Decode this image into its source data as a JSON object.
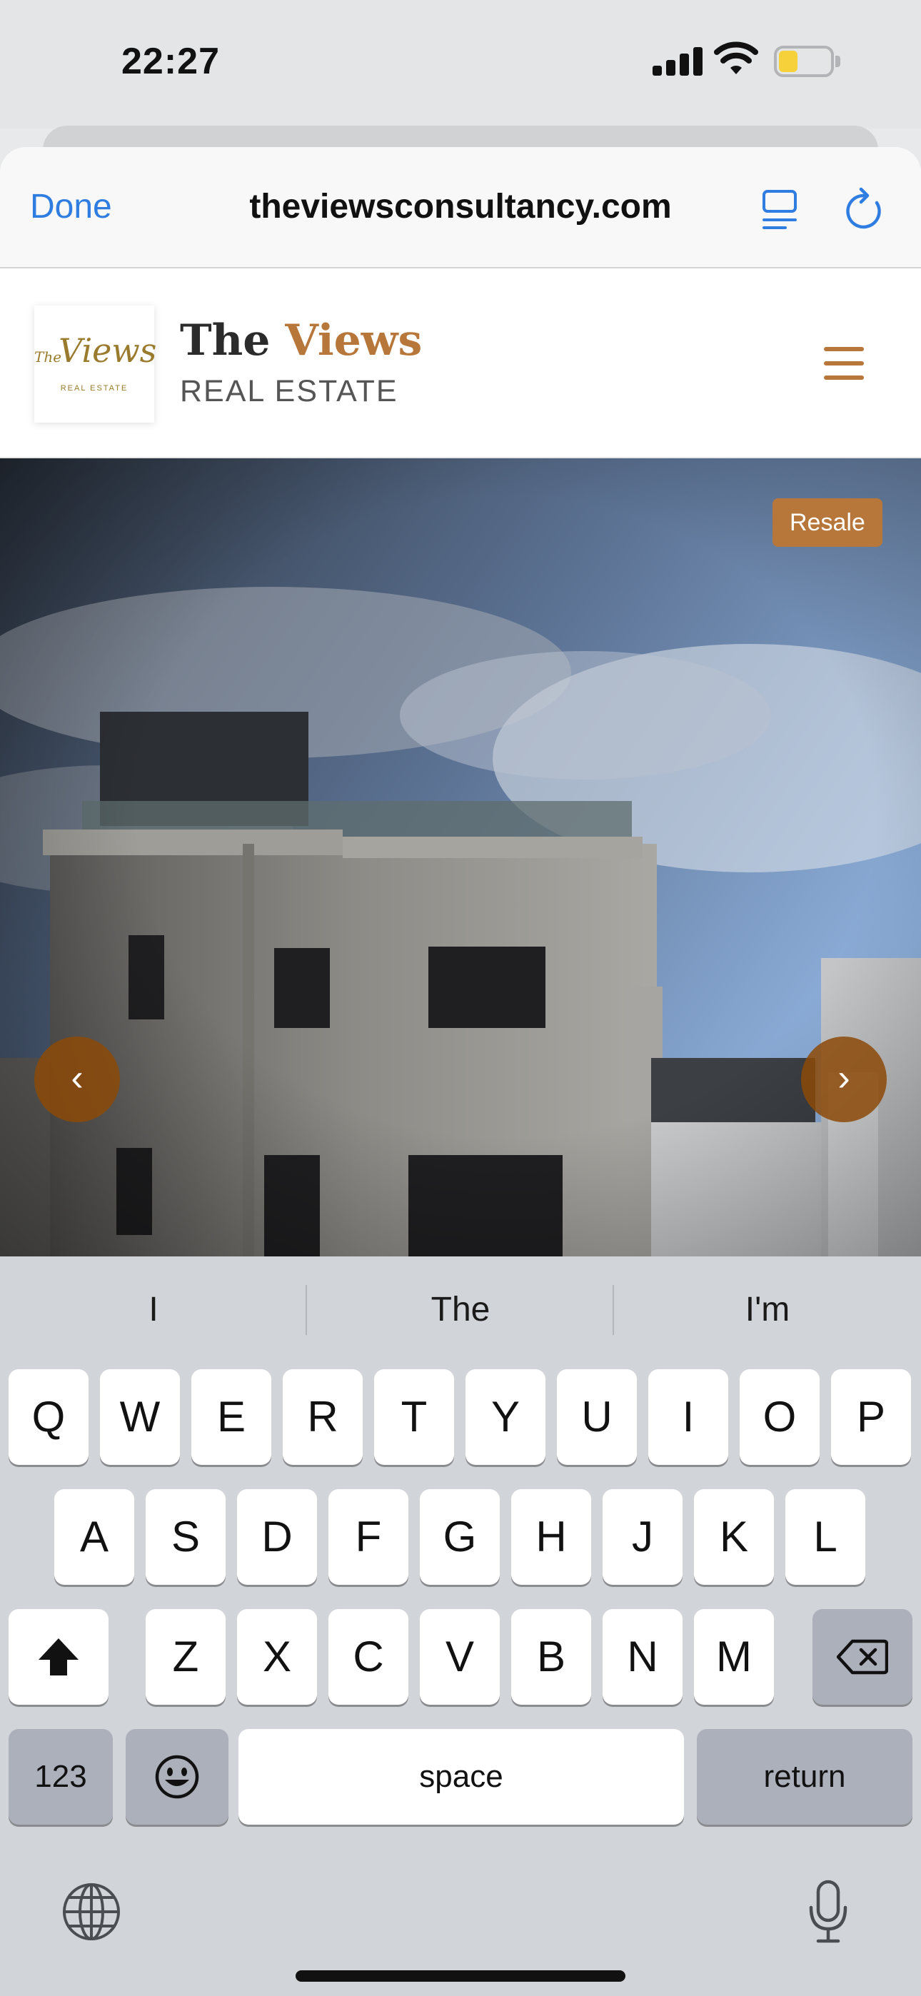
{
  "status_bar": {
    "time": "22:27",
    "icons": [
      "signal-icon",
      "wifi-icon",
      "battery-icon"
    ],
    "battery_color": "#f6d13a"
  },
  "browser": {
    "done_label": "Done",
    "url": "theviewsconsultancy.com",
    "accent_color": "#2f7de1",
    "icons": [
      "reader-icon",
      "reload-icon"
    ]
  },
  "site": {
    "logo": {
      "script": "Views",
      "the": "The",
      "sub": "REAL ESTATE"
    },
    "brand_title_dark": "The ",
    "brand_title_accent": "Views",
    "brand_subtitle": "REAL ESTATE",
    "accent_color": "#b8773a",
    "menu_icon": "hamburger-icon"
  },
  "hero": {
    "badge": "Resale",
    "prev_label": "‹",
    "next_label": "›"
  },
  "keyboard": {
    "suggestions": [
      "I",
      "The",
      "I'm"
    ],
    "rows": [
      [
        "Q",
        "W",
        "E",
        "R",
        "T",
        "Y",
        "U",
        "I",
        "O",
        "P"
      ],
      [
        "A",
        "S",
        "D",
        "F",
        "G",
        "H",
        "J",
        "K",
        "L"
      ],
      [
        "Z",
        "X",
        "C",
        "V",
        "B",
        "N",
        "M"
      ]
    ],
    "numbers_label": "123",
    "space_label": "space",
    "return_label": "return"
  }
}
